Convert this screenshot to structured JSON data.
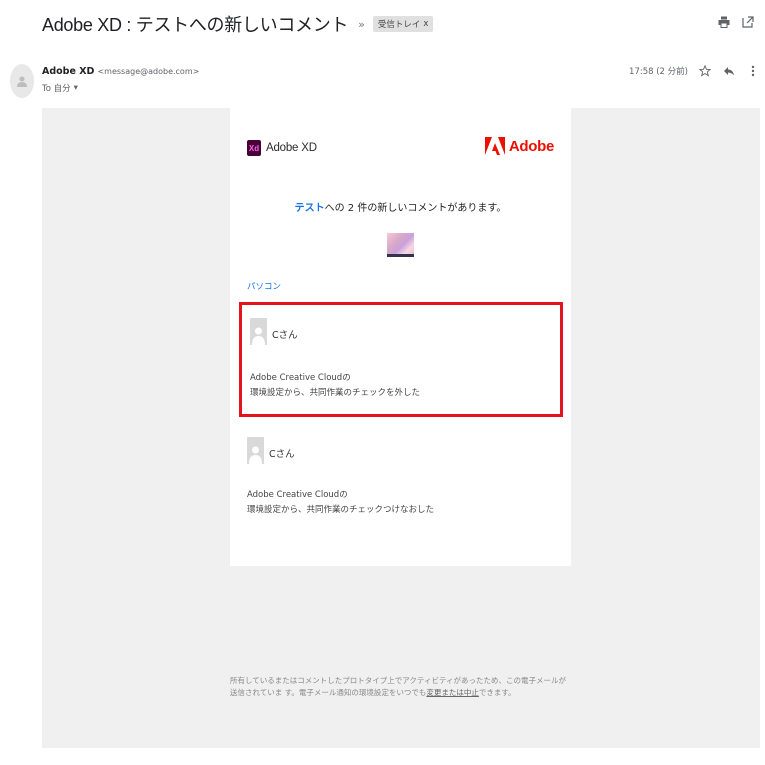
{
  "email": {
    "subject": "Adobe XD : テストへの新しいコメント",
    "importance_marker": "»",
    "label": "受信トレイ",
    "label_remove": "x"
  },
  "sender": {
    "name": "Adobe XD",
    "email": "<message@adobe.com>",
    "to_label": "To 自分",
    "to_caret": "▾",
    "timestamp": "17:58 (2 分前)"
  },
  "body": {
    "xd_badge": "Xd",
    "xd_name": "Adobe XD",
    "adobe_name": "Adobe",
    "headline_link": "テスト",
    "headline_rest": "への 2 件の新しいコメントがあります。",
    "section_link": "パソコン",
    "comments": [
      {
        "author": "Cさん",
        "line1": "Adobe Creative Cloudの",
        "line2": "環境設定から、共同作業のチェックを外した"
      },
      {
        "author": "Cさん",
        "line1": "Adobe Creative Cloudの",
        "line2": "環境設定から、共同作業のチェックつけなおした"
      }
    ]
  },
  "footer": {
    "text_part1": "所有しているまたはコメントしたプロトタイプ上でアクティビティがあったため、この電子メールが送信されていま す。電子メール通知の環境設定をいつでも",
    "link": "変更または中止",
    "text_part2": "できます。"
  },
  "icons": {
    "print": "print-icon",
    "open_new_window": "open-in-new-window-icon",
    "star": "star-icon",
    "reply": "reply-icon",
    "more": "more-vert-icon"
  },
  "colors": {
    "adobe_red": "#eb1000",
    "xd_purple": "#470137",
    "xd_pink": "#ff61f6",
    "link_blue": "#1473e6",
    "highlight_red": "#e3141c"
  }
}
